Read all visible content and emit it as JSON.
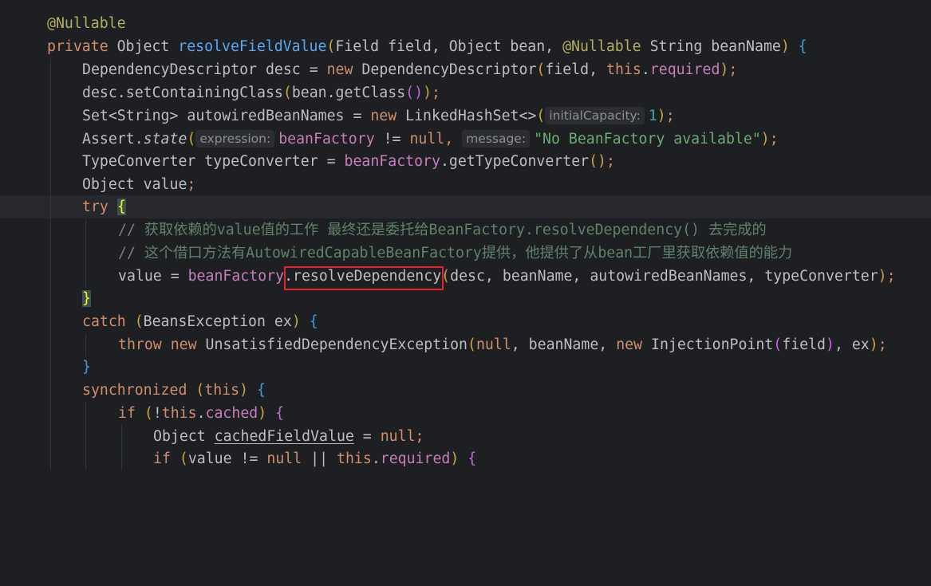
{
  "code": {
    "l1": [
      "@Nullable"
    ],
    "l2": [
      "private",
      " Object ",
      "resolveFieldValue",
      "(",
      "Field field, Object bean, ",
      "@Nullable",
      " String beanName",
      ")",
      " {"
    ],
    "l3": [
      "DependencyDescriptor desc = ",
      "new",
      " DependencyDescriptor",
      "(",
      "field, ",
      "this",
      ".",
      "required",
      ")",
      ";"
    ],
    "l4": [
      "desc.setContainingClass",
      "(",
      "bean.getClass",
      "()",
      ")",
      ";"
    ],
    "l5": [
      "Set<String> autowiredBeanNames = ",
      "new",
      " LinkedHashSet<>",
      "(",
      "initialCapacity:",
      "1",
      ")",
      ";"
    ],
    "l6": [
      "Assert.",
      "state",
      "(",
      "expression:",
      "beanFactory",
      " != ",
      "null",
      ", ",
      "message:",
      "\"No BeanFactory available\"",
      ")",
      ";"
    ],
    "l7": [
      "TypeConverter typeConverter = ",
      "beanFactory",
      ".getTypeConverter",
      "()",
      ";"
    ],
    "l8": [
      "Object value",
      ";"
    ],
    "l9": [
      "try",
      " ",
      "{"
    ],
    "l10": [
      "// ",
      "获取依赖的value值的工作 最终还是委托给BeanFactory.resolveDependency() 去完成的"
    ],
    "l11": [
      "// ",
      "这个借口方法有AutowiredCapableBeanFactory提供，他提供了从bean工厂里获取依赖值的能力"
    ],
    "l12": [
      "value = ",
      "beanFactory",
      ".resolveDependency",
      "(",
      "desc, beanName, autowiredBeanNames, typeConverter",
      ")",
      ";"
    ],
    "l13": [
      "}"
    ],
    "l14": [
      "catch",
      " ",
      "(",
      "BeansException ex",
      ")",
      " {"
    ],
    "l15": [
      "throw",
      " ",
      "new",
      " UnsatisfiedDependencyException",
      "(",
      "null",
      ", beanName, ",
      "new",
      " InjectionPoint",
      "(",
      "field",
      ")",
      ", ex",
      ")",
      ";"
    ],
    "l16": [
      "}"
    ],
    "l17": [
      "synchronized",
      " ",
      "(",
      "this",
      ")",
      " {"
    ],
    "l18": [
      "if",
      " ",
      "(",
      "!",
      "this",
      ".",
      "cached",
      ")",
      " {"
    ],
    "l19": [
      "Object ",
      "cachedFieldValue",
      " = ",
      "null",
      ";"
    ],
    "l20": [
      "if",
      " ",
      "(",
      "value != ",
      "null",
      " || ",
      "this",
      ".",
      "required",
      ")",
      " {"
    ]
  },
  "colors": {
    "background": "#1e1f22",
    "keyword": "#cf8e6d",
    "annotation": "#b3ae60",
    "method_declaration": "#56a8f5",
    "field": "#c77dbb",
    "string": "#6aab73",
    "number": "#2aacb8",
    "highlight_box": "#e0262e"
  }
}
